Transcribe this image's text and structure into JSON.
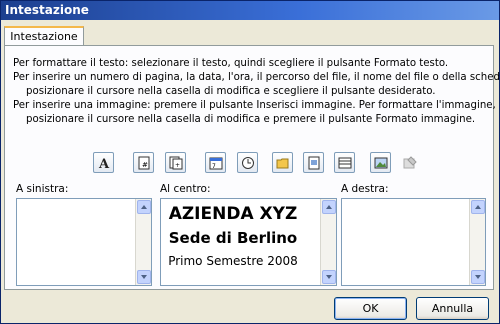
{
  "window": {
    "title": "Intestazione"
  },
  "tab": {
    "label": "Intestazione"
  },
  "instructions": [
    "Per formattare il testo: selezionare il testo, quindi scegliere il pulsante Formato testo.",
    "Per inserire un numero di pagina, la data, l'ora, il percorso del file, il nome del file o della scheda,",
    "posizionare il cursore nella casella di modifica e scegliere il pulsante desiderato.",
    "Per inserire una immagine: premere il pulsante Inserisci immagine. Per formattare l'immagine,",
    "posizionare il cursore nella casella di modifica e premere il pulsante Formato immagine."
  ],
  "toolbar": [
    {
      "name": "format-text",
      "icon": "format-text-icon"
    },
    {
      "name": "page-number",
      "icon": "page-number-icon"
    },
    {
      "name": "page-count",
      "icon": "page-count-icon"
    },
    {
      "name": "date",
      "icon": "calendar-icon"
    },
    {
      "name": "time",
      "icon": "clock-icon"
    },
    {
      "name": "file-path",
      "icon": "folder-icon"
    },
    {
      "name": "file-name",
      "icon": "file-icon"
    },
    {
      "name": "sheet-name",
      "icon": "sheet-icon"
    },
    {
      "name": "insert-picture",
      "icon": "picture-icon"
    },
    {
      "name": "format-picture",
      "icon": "format-picture-icon"
    }
  ],
  "sections": {
    "left": {
      "label": "A sinistra:"
    },
    "center": {
      "label": "Al centro:",
      "lines": [
        "AZIENDA XYZ",
        "Sede di Berlino",
        "Primo Semestre 2008"
      ]
    },
    "right": {
      "label": "A destra:"
    }
  },
  "buttons": {
    "ok": "OK",
    "cancel": "Annulla"
  }
}
